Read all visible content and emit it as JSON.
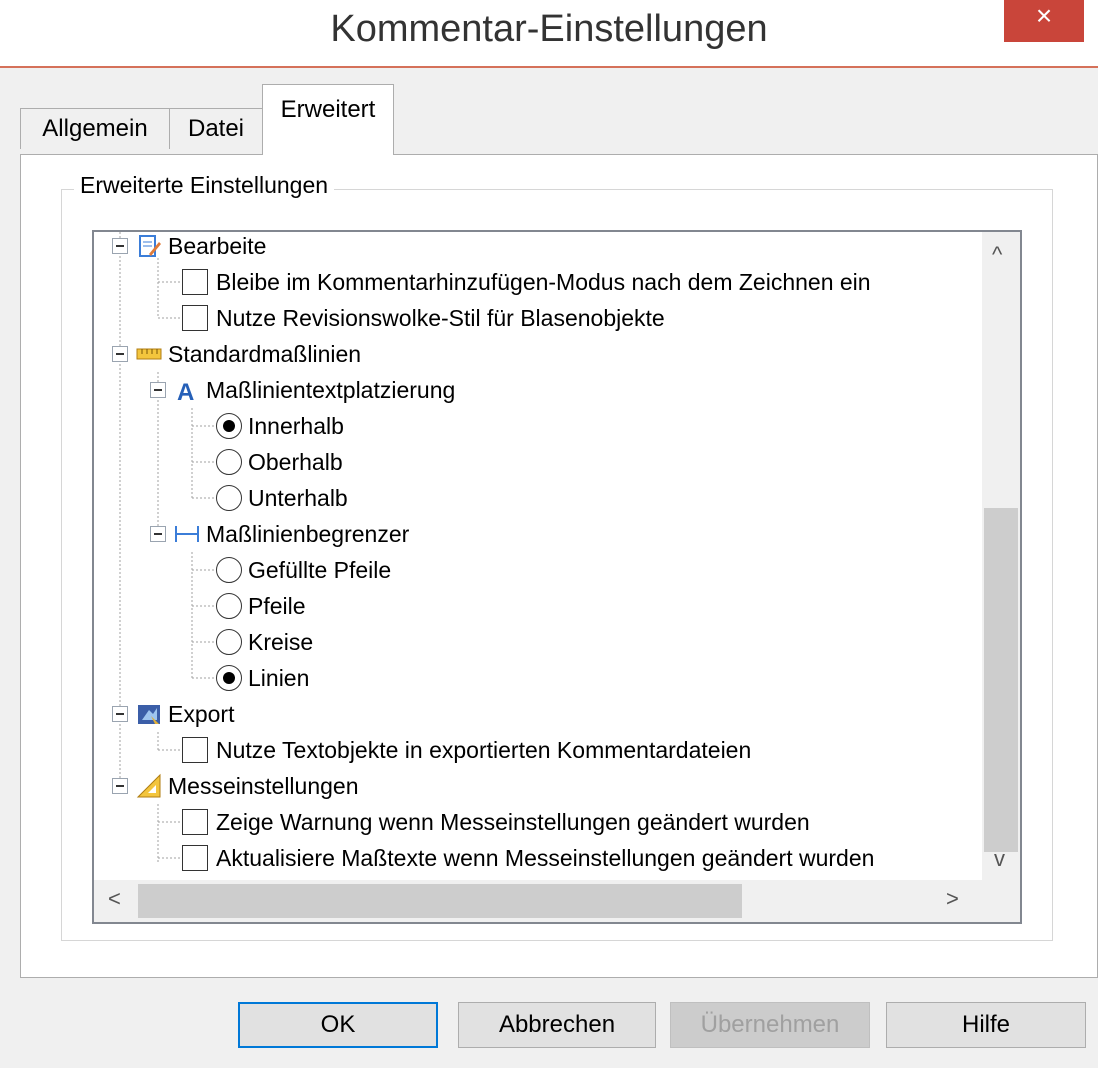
{
  "window": {
    "title": "Kommentar-Einstellungen",
    "close_glyph": "×"
  },
  "tabs": [
    {
      "label": "Allgemein",
      "active": false
    },
    {
      "label": "Datei",
      "active": false
    },
    {
      "label": "Erweitert",
      "active": true
    }
  ],
  "group": {
    "label": "Erweiterte Einstellungen"
  },
  "tree": {
    "bearbeite": {
      "label": "Bearbeite",
      "icon": "edit-document-icon",
      "items": [
        {
          "label": "Bleibe im Kommentarhinzufügen-Modus nach dem Zeichnen ein",
          "checked": false
        },
        {
          "label": "Nutze Revisionswolke-Stil für Blasenobjekte",
          "checked": false
        }
      ]
    },
    "standard": {
      "label": "Standardmaßlinien",
      "icon": "ruler-icon",
      "placement": {
        "label": "Maßlinientextplatzierung",
        "icon": "text-a-icon",
        "options": [
          {
            "label": "Innerhalb",
            "selected": true
          },
          {
            "label": "Oberhalb",
            "selected": false
          },
          {
            "label": "Unterhalb",
            "selected": false
          }
        ]
      },
      "limiter": {
        "label": "Maßlinienbegrenzer",
        "icon": "dimension-line-icon",
        "options": [
          {
            "label": "Gefüllte Pfeile",
            "selected": false
          },
          {
            "label": "Pfeile",
            "selected": false
          },
          {
            "label": "Kreise",
            "selected": false
          },
          {
            "label": "Linien",
            "selected": true
          }
        ]
      }
    },
    "export": {
      "label": "Export",
      "icon": "export-icon",
      "items": [
        {
          "label": "Nutze Textobjekte in exportierten Kommentardateien",
          "checked": false
        }
      ]
    },
    "messe": {
      "label": "Messeinstellungen",
      "icon": "set-square-icon",
      "items": [
        {
          "label": "Zeige Warnung wenn Messeinstellungen geändert wurden",
          "checked": false
        },
        {
          "label": "Aktualisiere Maßtexte wenn Messeinstellungen geändert wurden",
          "checked": false
        }
      ]
    }
  },
  "buttons": {
    "ok": "OK",
    "cancel": "Abbrechen",
    "apply": "Übernehmen",
    "help": "Hilfe"
  },
  "scroll_glyphs": {
    "up": "^",
    "down": "v",
    "left": "<",
    "right": ">"
  },
  "colors": {
    "accent": "#0078d7",
    "close": "#c9453a",
    "title_border": "#d5715a"
  }
}
